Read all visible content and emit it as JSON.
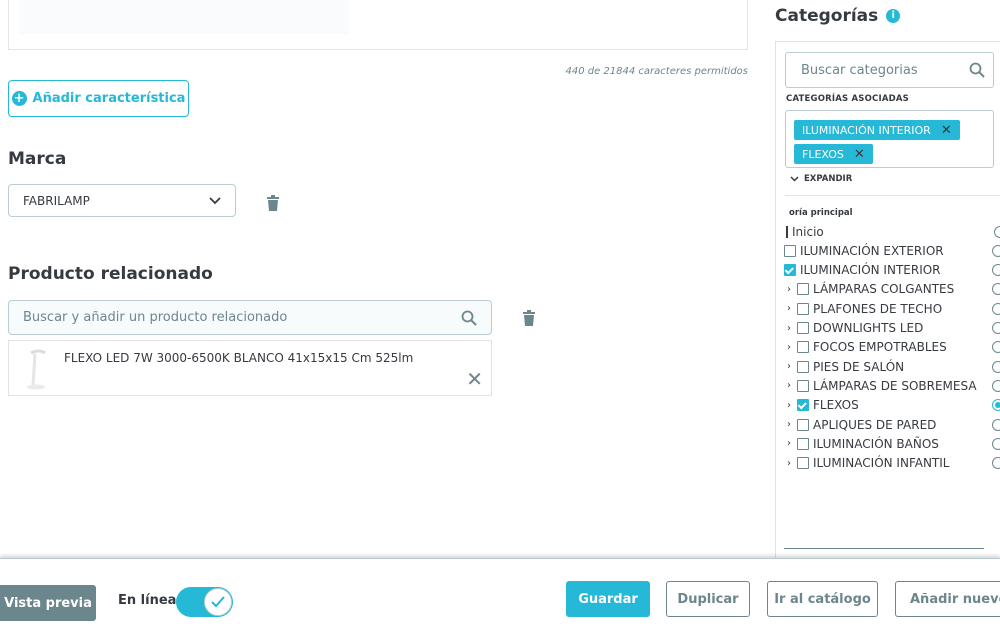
{
  "editor": {
    "char_count": "440 de 21844 caracteres permitidos"
  },
  "features": {
    "add_label": "Añadir característica"
  },
  "brand": {
    "title": "Marca",
    "selected": "FABRILAMP"
  },
  "related": {
    "title": "Producto relacionado",
    "search_placeholder": "Buscar y añadir un producto relacionado",
    "item_name": "FLEXO LED 7W 3000-6500K BLANCO 41x15x15 Cm 525lm"
  },
  "categories": {
    "title": "Categorías",
    "search_placeholder": "Buscar categorias",
    "associated_label": "CATEGORÍAS ASOCIADAS",
    "tags": [
      "ILUMINACIÓN INTERIOR",
      "FLEXOS"
    ],
    "expand_label": "EXPANDIR",
    "main_label": "oría principal",
    "tree": [
      {
        "label": "Inicio",
        "level": 0,
        "checkbox": false,
        "chevron": false,
        "checked": false,
        "main": false
      },
      {
        "label": "ILUMINACIÓN EXTERIOR",
        "level": 0,
        "checkbox": true,
        "chevron": false,
        "checked": false,
        "main": false
      },
      {
        "label": "ILUMINACIÓN INTERIOR",
        "level": 0,
        "checkbox": true,
        "chevron": false,
        "checked": true,
        "main": false
      },
      {
        "label": "LÁMPARAS COLGANTES",
        "level": 1,
        "checkbox": true,
        "chevron": true,
        "checked": false,
        "main": false
      },
      {
        "label": "PLAFONES DE TECHO",
        "level": 1,
        "checkbox": true,
        "chevron": true,
        "checked": false,
        "main": false
      },
      {
        "label": "DOWNLIGHTS LED",
        "level": 1,
        "checkbox": true,
        "chevron": true,
        "checked": false,
        "main": false
      },
      {
        "label": "FOCOS EMPOTRABLES",
        "level": 1,
        "checkbox": true,
        "chevron": true,
        "checked": false,
        "main": false
      },
      {
        "label": "PIES DE SALÓN",
        "level": 1,
        "checkbox": true,
        "chevron": true,
        "checked": false,
        "main": false
      },
      {
        "label": "LÁMPARAS DE SOBREMESA",
        "level": 1,
        "checkbox": true,
        "chevron": true,
        "checked": false,
        "main": false
      },
      {
        "label": "FLEXOS",
        "level": 1,
        "checkbox": true,
        "chevron": true,
        "checked": true,
        "main": true
      },
      {
        "label": "APLIQUES DE PARED",
        "level": 1,
        "checkbox": true,
        "chevron": true,
        "checked": false,
        "main": false
      },
      {
        "label": "ILUMINACIÓN BAÑOS",
        "level": 1,
        "checkbox": true,
        "chevron": true,
        "checked": false,
        "main": false
      },
      {
        "label": "ILUMINACIÓN INFANTIL",
        "level": 1,
        "checkbox": true,
        "chevron": true,
        "checked": false,
        "main": false
      }
    ]
  },
  "footer": {
    "preview_label": "Vista previa",
    "online_label": "En línea",
    "online": true,
    "save_label": "Guardar",
    "duplicate_label": "Duplicar",
    "catalog_label": "Ir al catálogo",
    "add_new_label": "Añadir nuevo p"
  },
  "colors": {
    "accent": "#25b9d7",
    "text": "#363a41",
    "muted": "#6c868e",
    "border": "#bbcdd2"
  }
}
